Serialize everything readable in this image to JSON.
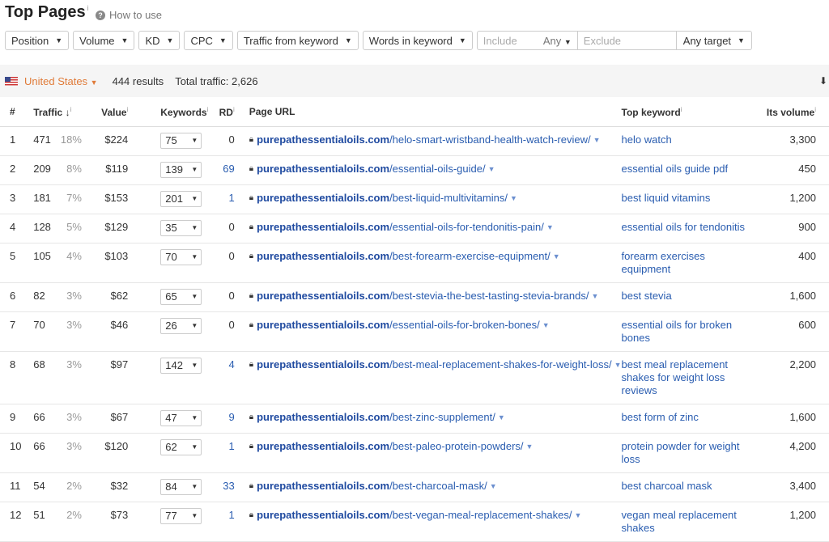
{
  "header": {
    "title": "Top Pages",
    "title_sup": "i",
    "how_to_use": "How to use"
  },
  "filters": {
    "position": "Position",
    "volume": "Volume",
    "kd": "KD",
    "cpc": "CPC",
    "traffic_from_keyword": "Traffic from keyword",
    "words_in_keyword": "Words in keyword",
    "include_placeholder": "Include",
    "any": "Any",
    "exclude_placeholder": "Exclude",
    "any_target": "Any target"
  },
  "infobar": {
    "country": "United States",
    "results": "444 results",
    "total_traffic": "Total traffic: 2,626"
  },
  "columns": {
    "num": "#",
    "traffic": "Traffic",
    "value": "Value",
    "keywords": "Keywords",
    "rd": "RD",
    "url": "Page URL",
    "top_keyword": "Top keyword",
    "volume": "Its volume"
  },
  "rows": [
    {
      "n": "1",
      "traffic": "471",
      "pct": "18%",
      "value": "$224",
      "kw": "75",
      "rd": "0",
      "domain": "purepathessentialoils.com",
      "path": "/helo-smart-wristband-health-watch-review/",
      "top": "helo watch",
      "vol": "3,300"
    },
    {
      "n": "2",
      "traffic": "209",
      "pct": "8%",
      "value": "$119",
      "kw": "139",
      "rd": "69",
      "domain": "purepathessentialoils.com",
      "path": "/essential-oils-guide/",
      "top": "essential oils guide pdf",
      "vol": "450"
    },
    {
      "n": "3",
      "traffic": "181",
      "pct": "7%",
      "value": "$153",
      "kw": "201",
      "rd": "1",
      "domain": "purepathessentialoils.com",
      "path": "/best-liquid-multivitamins/",
      "top": "best liquid vitamins",
      "vol": "1,200"
    },
    {
      "n": "4",
      "traffic": "128",
      "pct": "5%",
      "value": "$129",
      "kw": "35",
      "rd": "0",
      "domain": "purepathessentialoils.com",
      "path": "/essential-oils-for-tendonitis-pain/",
      "top": "essential oils for tendonitis",
      "vol": "900"
    },
    {
      "n": "5",
      "traffic": "105",
      "pct": "4%",
      "value": "$103",
      "kw": "70",
      "rd": "0",
      "domain": "purepathessentialoils.com",
      "path": "/best-forearm-exercise-equipment/",
      "top": "forearm exercises equipment",
      "vol": "400"
    },
    {
      "n": "6",
      "traffic": "82",
      "pct": "3%",
      "value": "$62",
      "kw": "65",
      "rd": "0",
      "domain": "purepathessentialoils.com",
      "path": "/best-stevia-the-best-tasting-stevia-brands/",
      "top": "best stevia",
      "vol": "1,600"
    },
    {
      "n": "7",
      "traffic": "70",
      "pct": "3%",
      "value": "$46",
      "kw": "26",
      "rd": "0",
      "domain": "purepathessentialoils.com",
      "path": "/essential-oils-for-broken-bones/",
      "top": "essential oils for broken bones",
      "vol": "600"
    },
    {
      "n": "8",
      "traffic": "68",
      "pct": "3%",
      "value": "$97",
      "kw": "142",
      "rd": "4",
      "domain": "purepathessentialoils.com",
      "path": "/best-meal-replacement-shakes-for-weight-loss/",
      "top": "best meal replacement shakes for weight loss reviews",
      "vol": "2,200"
    },
    {
      "n": "9",
      "traffic": "66",
      "pct": "3%",
      "value": "$67",
      "kw": "47",
      "rd": "9",
      "domain": "purepathessentialoils.com",
      "path": "/best-zinc-supplement/",
      "top": "best form of zinc",
      "vol": "1,600"
    },
    {
      "n": "10",
      "traffic": "66",
      "pct": "3%",
      "value": "$120",
      "kw": "62",
      "rd": "1",
      "domain": "purepathessentialoils.com",
      "path": "/best-paleo-protein-powders/",
      "top": "protein powder for weight loss",
      "vol": "4,200"
    },
    {
      "n": "11",
      "traffic": "54",
      "pct": "2%",
      "value": "$32",
      "kw": "84",
      "rd": "33",
      "domain": "purepathessentialoils.com",
      "path": "/best-charcoal-mask/",
      "top": "best charcoal mask",
      "vol": "3,400"
    },
    {
      "n": "12",
      "traffic": "51",
      "pct": "2%",
      "value": "$73",
      "kw": "77",
      "rd": "1",
      "domain": "purepathessentialoils.com",
      "path": "/best-vegan-meal-replacement-shakes/",
      "top": "vegan meal replacement shakes",
      "vol": "1,200"
    }
  ]
}
